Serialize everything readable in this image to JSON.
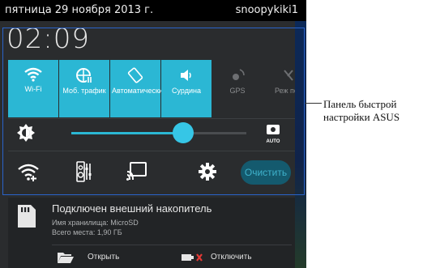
{
  "status_bar": {
    "date": "пятница 29 ноября 2013 г.",
    "user": "snoopykiki1"
  },
  "clock": "02:09",
  "quick_settings": [
    {
      "label": "Wi-Fi",
      "icon": "wifi-icon",
      "active": true
    },
    {
      "label": "Моб. трафик",
      "icon": "mobile-data-icon",
      "active": true
    },
    {
      "label": "Автоматический",
      "icon": "auto-rotate-icon",
      "active": true
    },
    {
      "label": "Сурдина",
      "icon": "volume-icon",
      "active": true
    },
    {
      "label": "GPS",
      "icon": "gps-icon",
      "active": false
    },
    {
      "label": "Реж пол",
      "icon": "mode-icon",
      "active": false
    }
  ],
  "brightness": {
    "level": 0.64,
    "auto_label": "AUTO"
  },
  "bottom_row": [
    "wifi-settings-icon",
    "audio-wizard-icon",
    "screen-cast-icon",
    "settings-gear-icon"
  ],
  "clear_button": "Очистить",
  "notification": {
    "title": "Подключен внешний накопитель",
    "storage_name": "Имя хранилища: MicroSD",
    "total_space": "Всего места: 1,90 ГБ",
    "open_label": "Открыть",
    "disconnect_label": "Отключить"
  },
  "callout": "Панель быстрой настройки ASUS",
  "colors": {
    "accent": "#2bb7d4",
    "frame": "#2a63c9"
  }
}
